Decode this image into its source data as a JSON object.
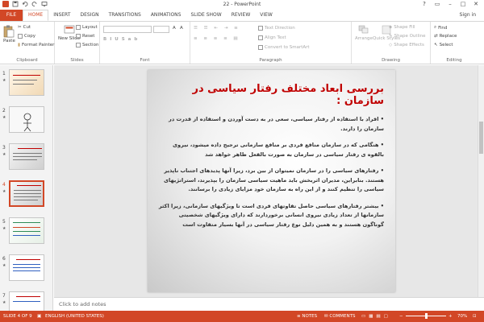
{
  "window": {
    "title": "22 - PowerPoint"
  },
  "tabs": [
    {
      "label": "FILE",
      "active": false,
      "file": true
    },
    {
      "label": "HOME",
      "active": true
    },
    {
      "label": "INSERT"
    },
    {
      "label": "DESIGN"
    },
    {
      "label": "TRANSITIONS"
    },
    {
      "label": "ANIMATIONS"
    },
    {
      "label": "SLIDE SHOW"
    },
    {
      "label": "REVIEW"
    },
    {
      "label": "VIEW"
    }
  ],
  "signin": "Sign in",
  "ribbon": {
    "clipboard": {
      "label": "Clipboard",
      "paste": "Paste",
      "cut": "Cut",
      "copy": "Copy",
      "format_painter": "Format Painter"
    },
    "slides": {
      "label": "Slides",
      "new_slide": "New Slide",
      "layout": "Layout",
      "reset": "Reset",
      "section": "Section"
    },
    "font": {
      "label": "Font"
    },
    "paragraph": {
      "label": "Paragraph",
      "text_direction": "Text Direction",
      "align_text": "Align Text",
      "smartart": "Convert to SmartArt"
    },
    "drawing": {
      "label": "Drawing",
      "arrange": "Arrange",
      "quick_styles": "Quick Styles",
      "shape_fill": "Shape Fill",
      "shape_outline": "Shape Outline",
      "shape_effects": "Shape Effects"
    },
    "editing": {
      "label": "Editing",
      "find": "Find",
      "replace": "Replace",
      "select": "Select"
    }
  },
  "thumbnails": [
    {
      "num": "1",
      "star": "★"
    },
    {
      "num": "2",
      "star": "★"
    },
    {
      "num": "3",
      "star": "★"
    },
    {
      "num": "4",
      "star": "★",
      "selected": true
    },
    {
      "num": "5",
      "star": "★"
    },
    {
      "num": "6",
      "star": "★"
    },
    {
      "num": "7",
      "star": "★"
    }
  ],
  "slide": {
    "title": "بررسی ابعاد مختلف رفتار سیاسی در سازمان :",
    "bullets": [
      "• افراد با استفاده از رفتار سیاسی، سعی در به دست آوردن و استفاده از قدرت در سازمان را دارند.",
      "• هنگامی که در سازمان منافع فردی بر منافع سازمانی ترجیح داده میشود، نیروی بالقوه ی رفتار سیاسی در سازمان به صورت بالفعل ظاهر خواهد شد",
      "• رفتارهای سیاسی را در سازمان نمیتوان از بین برد، زیرا آنها پدیدهای اجتناب ناپذیر هستند. بنابراین، مدیران اثربخش باید ماهیت سیاسی سازمان را بپذیرند، استراتژیهای سیاسی را تنظیم کنند و از این راه به سازمان خود مزایای زیادی را برسانند.",
      "• بیشتر رفتارهای سیاسی حاصل تفاوتهای فردی است تا ویژگیهای سازمانی، زیرا اکثر سازمانها از تعداد زیادی نیروی انسانی برخوردارند که دارای ویژگیهای شخصیتی گوناگون هستند و به همین دلیل نوع رفتار سیاسی در آنها بسیار متفاوت است"
    ]
  },
  "notes_placeholder": "Click to add notes",
  "status": {
    "slide_of": "SLIDE 4 OF 9",
    "language": "ENGLISH (UNITED STATES)",
    "notes": "NOTES",
    "comments": "COMMENTS",
    "zoom": "70%",
    "zoom_fraction": 0.5
  },
  "colors": {
    "accent": "#d24726",
    "title_red": "#c00000"
  }
}
